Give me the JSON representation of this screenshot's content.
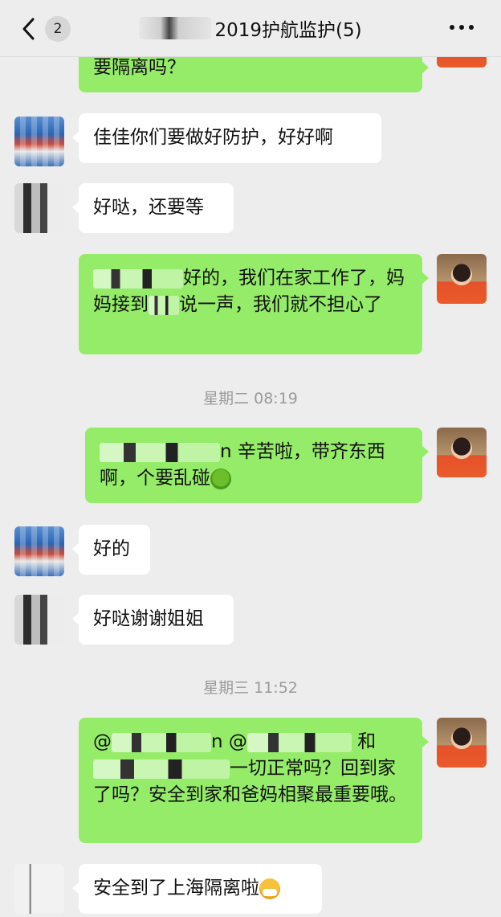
{
  "header": {
    "back_count": "2",
    "title": "2019护航监护(5)",
    "more_icon": "more-dots-icon"
  },
  "messages": [
    {
      "side": "right",
      "text": "要隔离吗？"
    },
    {
      "side": "left",
      "text": "佳佳你们要做好防护，好好啊"
    },
    {
      "side": "left",
      "text": "好哒，还要等"
    },
    {
      "side": "right",
      "text_before": "",
      "text_after": "好的，我们在家工作了，妈妈接到",
      "text_after2": "说一声，我们就不担心了"
    },
    {
      "side": "right",
      "text": "辛苦啦，带齐东西啊，个要乱碰",
      "prefix": "n "
    },
    {
      "side": "left",
      "text": "好的"
    },
    {
      "side": "left",
      "text": "好哒谢谢姐姐"
    },
    {
      "side": "right",
      "text_a": "@",
      "text_b": "n @",
      "text_c": "和",
      "text_d": "一切正常吗？回到家了吗？安全到家和爸妈相聚最重要哦。"
    },
    {
      "side": "left",
      "text": "安全到了上海隔离啦"
    }
  ],
  "timestamps": [
    "星期二 08:19",
    "星期三 11:52"
  ]
}
